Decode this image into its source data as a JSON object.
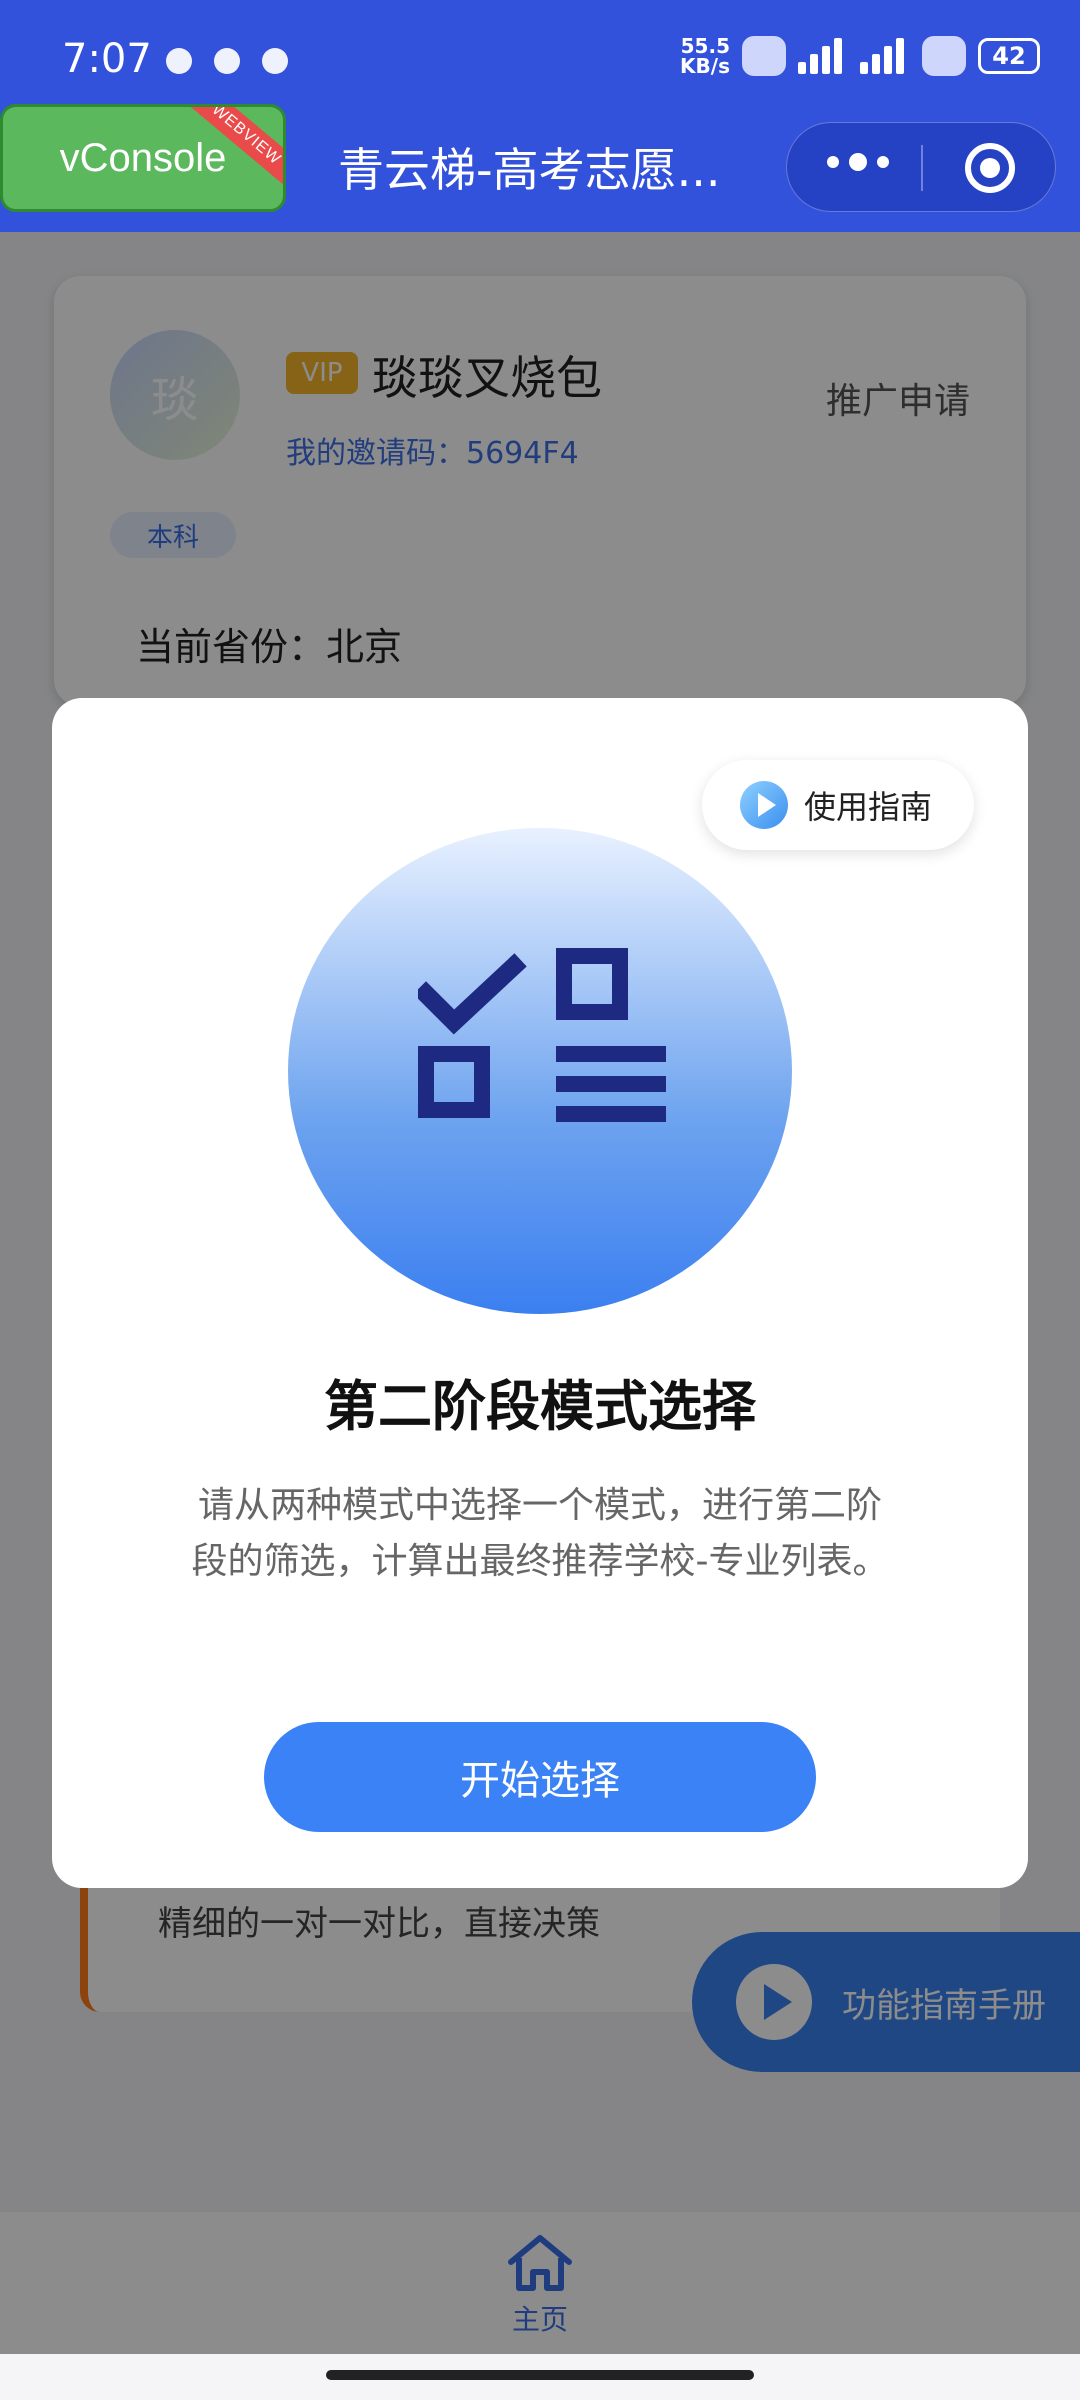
{
  "status_bar": {
    "time": "7:07",
    "net_speed_value": "55.5",
    "net_speed_unit": "KB/s",
    "battery": "42"
  },
  "vconsole": {
    "label": "vConsole",
    "ribbon": "WEBVIEW"
  },
  "nav": {
    "title": "青云梯-高考志愿..."
  },
  "profile": {
    "avatar_char": "琰",
    "degree": "本科",
    "vip_badge": "VIP",
    "username": "琰琰叉烧包",
    "invite_code": "我的邀请码：5694F4",
    "promo_link": "推广申请",
    "province": "当前省份：北京"
  },
  "background_card": {
    "partial_text": "精细的一对一对比，直接决策"
  },
  "floating": {
    "guide_manual": "功能指南手册"
  },
  "modal": {
    "guide_button": "使用指南",
    "title": "第二阶段模式选择",
    "description": "请从两种模式中选择一个模式，进行第二阶段的筛选，计算出最终推荐学校-专业列表。",
    "primary_button": "开始选择"
  },
  "tabbar": {
    "home_label": "主页"
  },
  "colors": {
    "brand_blue": "#3352dc",
    "primary_button": "#3b82f6",
    "vconsole_green": "#5cb85c",
    "vip_gold": "#f4b528"
  }
}
